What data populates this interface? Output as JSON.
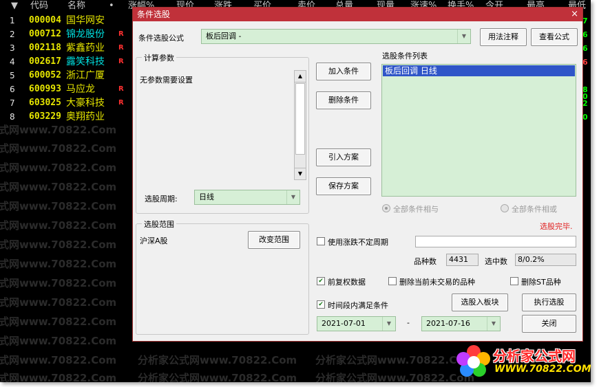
{
  "header": {
    "cols": [
      "代码",
      "名称",
      "•",
      "涨幅%",
      "现价",
      "涨跌",
      "买价",
      "卖价",
      "总量",
      "现量",
      "涨速%",
      "换手%",
      "今开",
      "最高",
      "最低"
    ]
  },
  "stocks": [
    {
      "idx": "1",
      "code": "000004",
      "name": "国华网安",
      "flag": ""
    },
    {
      "idx": "2",
      "code": "000712",
      "name": "锦龙股份",
      "flag": "R"
    },
    {
      "idx": "3",
      "code": "002118",
      "name": "紫鑫药业",
      "flag": "R"
    },
    {
      "idx": "4",
      "code": "002617",
      "name": "露笑科技",
      "flag": "R"
    },
    {
      "idx": "5",
      "code": "600052",
      "name": "浙江广厦",
      "flag": ""
    },
    {
      "idx": "6",
      "code": "600993",
      "name": "马应龙",
      "flag": "R"
    },
    {
      "idx": "7",
      "code": "603025",
      "name": "大豪科技",
      "flag": "R"
    },
    {
      "idx": "8",
      "code": "603229",
      "name": "奥翔药业",
      "flag": ""
    }
  ],
  "right_values": [
    "7",
    "6",
    "6",
    "6",
    "8",
    "0",
    "2",
    "0"
  ],
  "watermark": "分析家公式网www.70822.Com",
  "watermark_short": "式网www.70822.Com",
  "logo": {
    "line1": "分析家公式网",
    "line2": "WWW.70822.COM"
  },
  "dialog": {
    "title": "条件选股",
    "close": "×",
    "formula_label": "条件选股公式",
    "formula_value": "板后回调    -",
    "usage_button": "用法注释",
    "view_button": "查看公式",
    "params_group": "计算参数",
    "params_text": "无参数需要设置",
    "period_label": "选股周期:",
    "period_value": "日线",
    "range_group": "选股范围",
    "range_value": "沪深A股",
    "change_range_button": "改变范围",
    "add_button": "加入条件",
    "delete_button": "删除条件",
    "import_button": "引入方案",
    "save_button": "保存方案",
    "list_label": "选股条件列表",
    "list_items": [
      "板后回调  日线"
    ],
    "and_option": "全部条件相与",
    "or_option": "全部条件相或",
    "status": "选股完毕.",
    "uncertain_period": "使用涨跌不定周期",
    "count_label": "品种数",
    "count_value": "4431",
    "selected_label": "选中数",
    "selected_value": "8/0.2%",
    "restore_label": "前复权数据",
    "delete_untraded": "删除当前未交易的品种",
    "delete_st": "删除ST品种",
    "time_range_label": "时间段内满足条件",
    "to_board_button": "选股入板块",
    "execute_button": "执行选股",
    "date_from": "2021-07-01",
    "date_sep": "-",
    "date_to": "2021-07-16",
    "close_button": "关闭"
  }
}
